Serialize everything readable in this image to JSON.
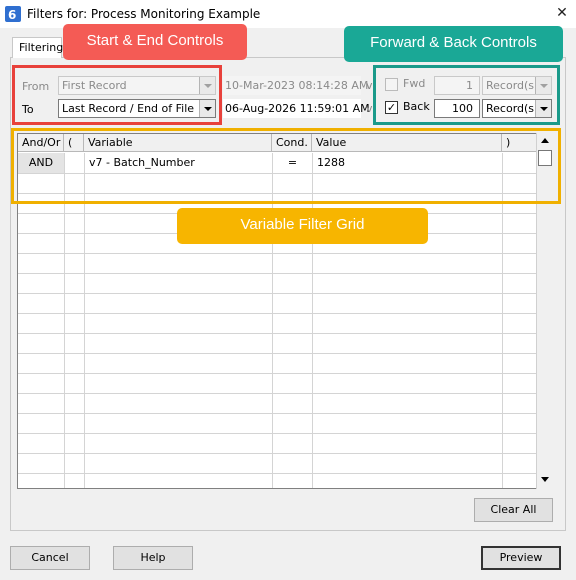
{
  "window": {
    "title": "Filters for: Process Monitoring Example",
    "app_icon_glyph": "6",
    "close_glyph": "✕"
  },
  "tabs": [
    {
      "label": "Filtering"
    }
  ],
  "start_end": {
    "from_label": "From",
    "to_label": "To",
    "from_value": "First Record",
    "to_value": "Last Record / End of File",
    "from_datetime": "10-Mar-2023  08:14:28 AM",
    "to_datetime": "06-Aug-2026  11:59:01 AM",
    "trailing_glyph": "v"
  },
  "fwd_back": {
    "fwd_label": "Fwd",
    "fwd_checked": false,
    "fwd_value": "1",
    "fwd_unit": "Record(s)",
    "back_label": "Back",
    "back_checked": true,
    "check_glyph": "✓",
    "back_value": "100",
    "back_unit": "Record(s)"
  },
  "grid": {
    "headers": [
      "And/Or",
      "(",
      "Variable",
      "Cond.",
      "Value",
      ")"
    ],
    "rows": [
      {
        "andor": "AND",
        "open": "",
        "variable": "v7 - Batch_Number",
        "cond": "=",
        "value": "1288",
        "close": ""
      }
    ]
  },
  "buttons": {
    "clear_all": "Clear All",
    "cancel": "Cancel",
    "help": "Help",
    "preview": "Preview"
  },
  "annotations": {
    "start_end_label": "Start & End Controls",
    "fwd_back_label": "Forward & Back Controls",
    "grid_label": "Variable Filter Grid",
    "colors": {
      "red": "#f45b55",
      "red_box": "#e8413b",
      "teal": "#1aa896",
      "teal_box": "#1a9a8a",
      "amber": "#f7b500",
      "amber_box": "#f0b000"
    }
  }
}
